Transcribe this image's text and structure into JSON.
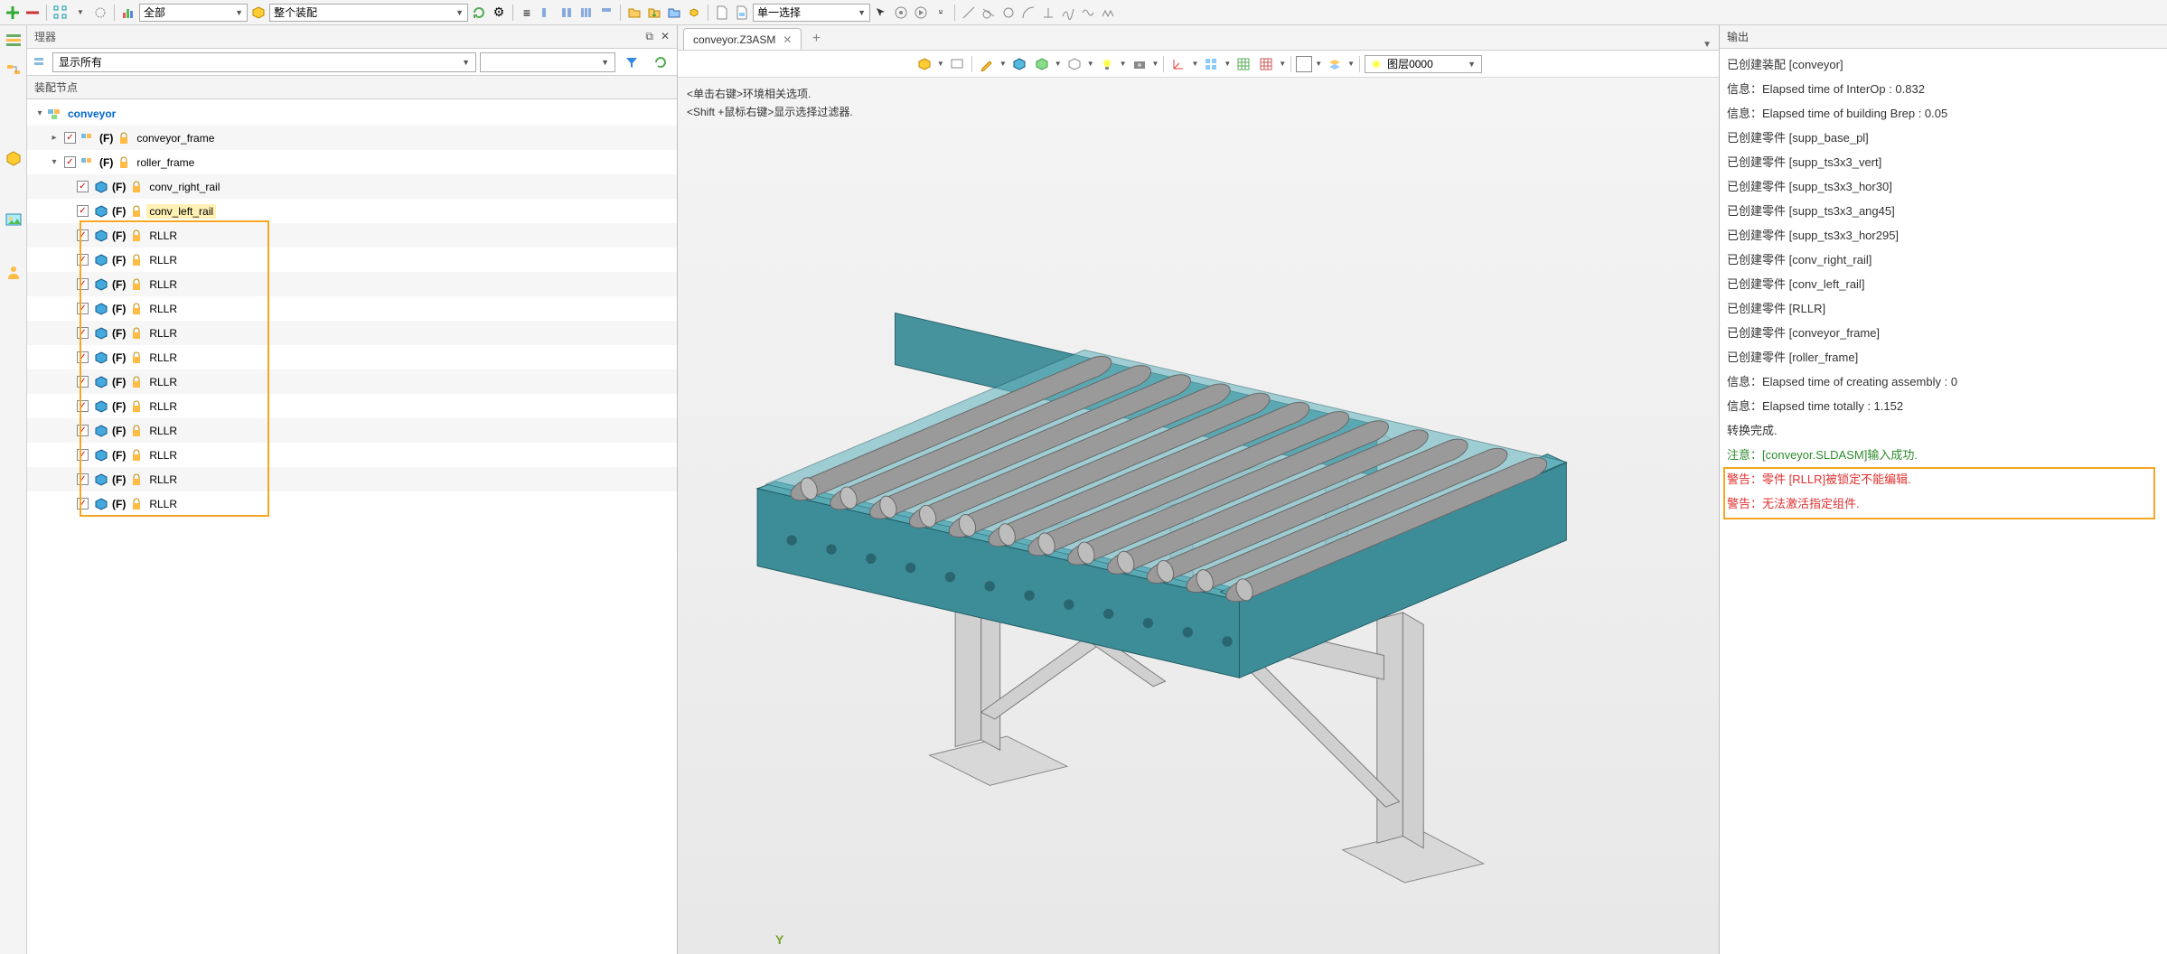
{
  "toolbar": {
    "combo_all": "全部",
    "combo_scope": "整个装配",
    "combo_sel": "单一选择"
  },
  "manager": {
    "title": "理器",
    "filter_label": "显示所有",
    "section": "装配节点"
  },
  "tree": {
    "root": "conveyor",
    "f1": "(F)",
    "n1": "conveyor_frame",
    "n2": "roller_frame",
    "n3": "conv_right_rail",
    "n4": "conv_left_rail",
    "rllr": "RLLR"
  },
  "tab": {
    "name": "conveyor.Z3ASM"
  },
  "hints": {
    "l1": "<单击右键>环境相关选项.",
    "l2": "<Shift +鼠标右键>显示选择过滤器."
  },
  "axis_y": "Y",
  "layer": {
    "label": "图层0000"
  },
  "output": {
    "title": "输出",
    "lines": [
      {
        "t": "已创建装配 [conveyor]",
        "c": ""
      },
      {
        "t": "信息：Elapsed time of InterOp : 0.832",
        "c": ""
      },
      {
        "t": "信息：Elapsed time of building Brep : 0.05",
        "c": ""
      },
      {
        "t": "已创建零件 [supp_base_pl]",
        "c": ""
      },
      {
        "t": "已创建零件 [supp_ts3x3_vert]",
        "c": ""
      },
      {
        "t": "已创建零件 [supp_ts3x3_hor30]",
        "c": ""
      },
      {
        "t": "已创建零件 [supp_ts3x3_ang45]",
        "c": ""
      },
      {
        "t": "已创建零件 [supp_ts3x3_hor295]",
        "c": ""
      },
      {
        "t": "已创建零件 [conv_right_rail]",
        "c": ""
      },
      {
        "t": "已创建零件 [conv_left_rail]",
        "c": ""
      },
      {
        "t": "已创建零件 [RLLR]",
        "c": ""
      },
      {
        "t": "已创建零件 [conveyor_frame]",
        "c": ""
      },
      {
        "t": "已创建零件 [roller_frame]",
        "c": ""
      },
      {
        "t": "信息：Elapsed time of creating assembly : 0",
        "c": ""
      },
      {
        "t": "信息：Elapsed time totally : 1.152",
        "c": ""
      },
      {
        "t": "转换完成.",
        "c": ""
      },
      {
        "t": "注意：[conveyor.SLDASM]输入成功.",
        "c": "green"
      },
      {
        "t": "警告：零件 [RLLR]被锁定不能编辑.",
        "c": "red"
      },
      {
        "t": "警告：无法激活指定组件.",
        "c": "red"
      }
    ]
  }
}
